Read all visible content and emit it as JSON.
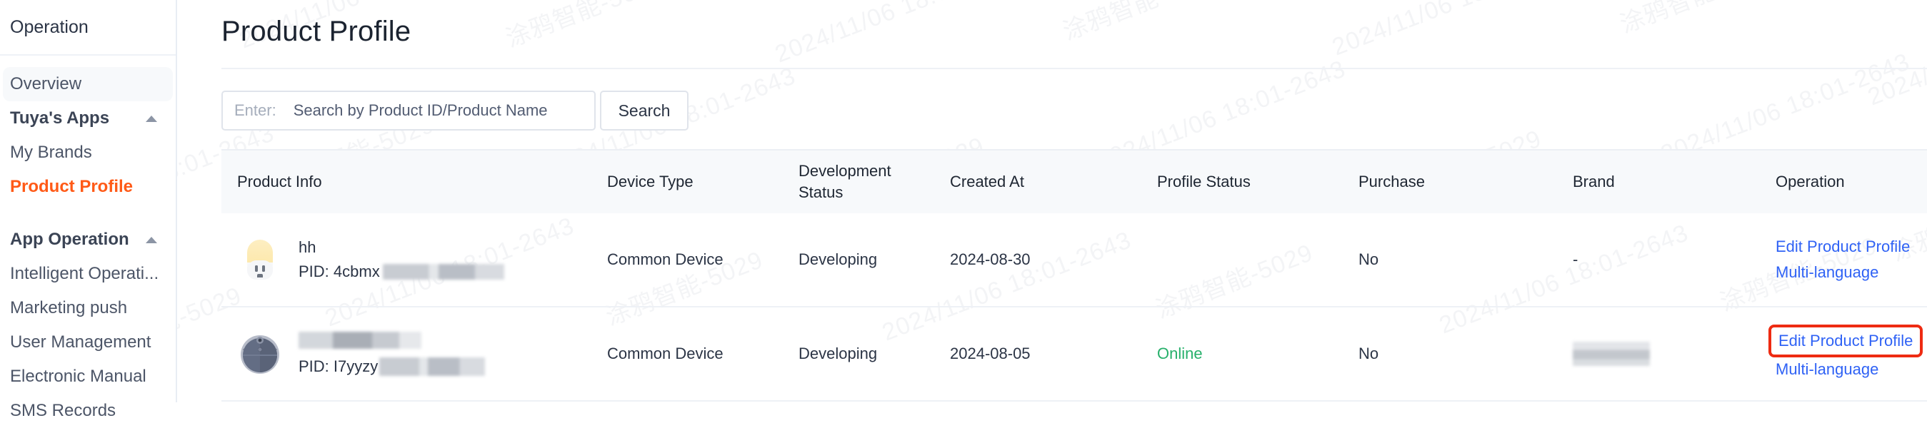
{
  "sidebar": {
    "header_title": "Operation",
    "items": [
      {
        "label": "Overview",
        "type": "link",
        "state": "hover"
      },
      {
        "label": "Tuya's Apps",
        "type": "group",
        "icon": "chevron-up-icon"
      },
      {
        "label": "My Brands",
        "type": "link",
        "state": "normal"
      },
      {
        "label": "Product Profile",
        "type": "link",
        "state": "selected"
      },
      {
        "label": "App Operation",
        "type": "group",
        "icon": "chevron-up-icon"
      },
      {
        "label": "Intelligent Operati...",
        "type": "link",
        "state": "normal"
      },
      {
        "label": "Marketing push",
        "type": "link",
        "state": "normal"
      },
      {
        "label": "User Management",
        "type": "link",
        "state": "normal"
      },
      {
        "label": "Electronic Manual",
        "type": "link",
        "state": "normal"
      },
      {
        "label": "SMS Records",
        "type": "link",
        "state": "normal"
      }
    ]
  },
  "page": {
    "title": "Product Profile"
  },
  "search": {
    "prefix_label": "Enter:",
    "placeholder": "Search by Product ID/Product Name",
    "value": "",
    "button_label": "Search"
  },
  "table": {
    "columns": [
      {
        "key": "product_info",
        "label": "Product Info"
      },
      {
        "key": "device_type",
        "label": "Device Type"
      },
      {
        "key": "development_status",
        "label": "Development Status",
        "line1": "Development",
        "line2": "Status"
      },
      {
        "key": "created_at",
        "label": "Created At"
      },
      {
        "key": "profile_status",
        "label": "Profile Status"
      },
      {
        "key": "purchase",
        "label": "Purchase"
      },
      {
        "key": "brand",
        "label": "Brand"
      },
      {
        "key": "operation",
        "label": "Operation"
      }
    ],
    "rows": [
      {
        "icon": "night-light-outlet-icon",
        "product_name": "hh",
        "pid_label": "PID: 4cbmx",
        "pid_redacted": true,
        "product_name_redacted": false,
        "device_type": "Common Device",
        "development_status": "Developing",
        "created_at": "2024-08-30",
        "profile_status": "",
        "purchase": "No",
        "brand": "-",
        "brand_redacted": false,
        "operations": [
          {
            "label": "Edit Product Profile",
            "highlighted": false
          },
          {
            "label": "Multi-language",
            "highlighted": false
          }
        ]
      },
      {
        "icon": "robot-vacuum-icon",
        "product_name": "",
        "pid_label": "PID: I7yyzy",
        "pid_redacted": true,
        "product_name_redacted": true,
        "device_type": "Common Device",
        "development_status": "Developing",
        "created_at": "2024-08-05",
        "profile_status": "Online",
        "purchase": "No",
        "brand": "",
        "brand_redacted": true,
        "operations": [
          {
            "label": "Edit Product Profile",
            "highlighted": true
          },
          {
            "label": "Multi-language",
            "highlighted": false
          }
        ]
      }
    ]
  },
  "colors": {
    "accent_selected": "#ff5a17",
    "link": "#2f62f5",
    "status_online": "#27b06b",
    "highlight_box": "#ee2b12",
    "header_bg": "#f7f9fb"
  },
  "watermark": {
    "text_primary": "涂鸦智能-5029",
    "text_secondary": "2024/11/06 18:01-2643"
  }
}
